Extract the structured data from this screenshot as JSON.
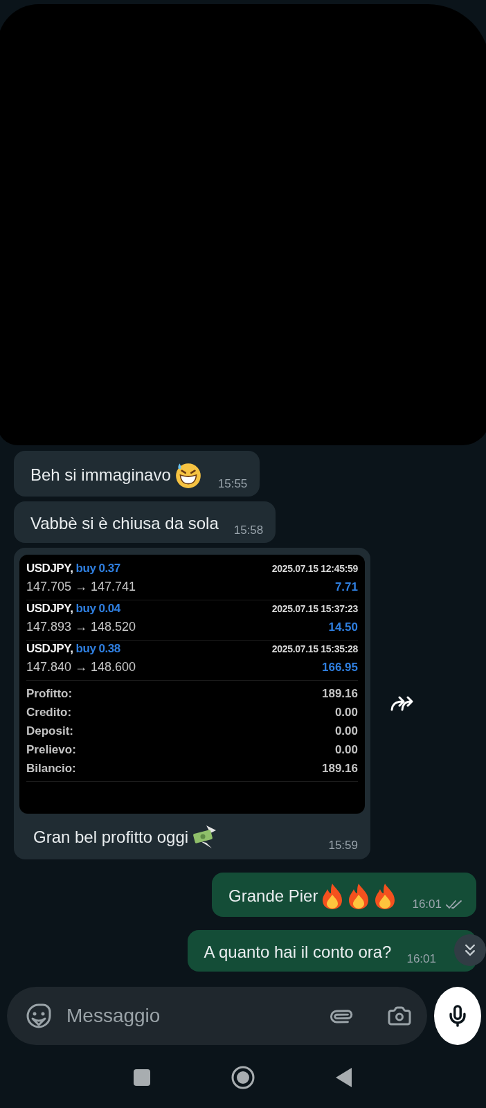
{
  "messages": [
    {
      "outgoing": false,
      "text": "Beh si immaginavo",
      "emojis": [
        {
          "kind": "grin_sweat"
        }
      ],
      "time": "15:55"
    },
    {
      "outgoing": false,
      "text": "Vabbè si è chiusa da sola",
      "time": "15:58"
    },
    {
      "outgoing": false,
      "kind": "image",
      "caption": "Gran bel profitto oggi",
      "emojis": [
        {
          "kind": "money_wings"
        }
      ],
      "time": "15:59",
      "forward": true,
      "report": {
        "trades": [
          {
            "symbol": "USDJPY,",
            "side": "buy 0.37",
            "datetime": "2025.07.15 12:45:59",
            "prices": "147.705 → 147.741",
            "profit": "7.71"
          },
          {
            "symbol": "USDJPY,",
            "side": "buy 0.04",
            "datetime": "2025.07.15 15:37:23",
            "prices": "147.893 → 148.520",
            "profit": "14.50"
          },
          {
            "symbol": "USDJPY,",
            "side": "buy 0.38",
            "datetime": "2025.07.15 15:35:28",
            "prices": "147.840 → 148.600",
            "profit": "166.95"
          }
        ],
        "summary": [
          {
            "label": "Profitto:",
            "value": "189.16"
          },
          {
            "label": "Credito:",
            "value": "0.00"
          },
          {
            "label": "Deposit:",
            "value": "0.00"
          },
          {
            "label": "Prelievo:",
            "value": "0.00"
          },
          {
            "label": "Bilancio:",
            "value": "189.16"
          }
        ]
      }
    },
    {
      "outgoing": true,
      "text": "Grande Pier",
      "emojis": [
        {
          "kind": "fire"
        },
        {
          "kind": "fire"
        },
        {
          "kind": "fire"
        }
      ],
      "time": "16:01",
      "read": false
    },
    {
      "outgoing": true,
      "text": "A quanto hai il conto ora?",
      "time": "16:01"
    }
  ],
  "composer": {
    "placeholder": "Messaggio"
  }
}
